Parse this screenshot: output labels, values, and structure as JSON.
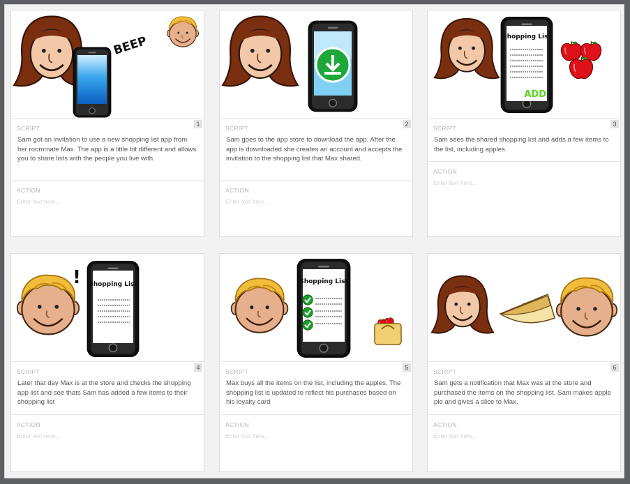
{
  "labels": {
    "script": "SCRIPT",
    "action": "ACTION",
    "placeholder": "Enter text here..."
  },
  "panels": [
    {
      "number": "1",
      "script": "Sam got an invitation to use a  new shopping list app from her roommate Max. The app is a little bit different and allows you to share lists with the people you live with.",
      "picture": {
        "sound": "BEEP"
      }
    },
    {
      "number": "2",
      "script": "Sam goes to the app store to download the app. After the app is downloaded she creates an account and accepts the invitation to the shopping list that Max shared."
    },
    {
      "number": "3",
      "script": "Sam sees the shared shopping list and adds a few items to the list, including apples.",
      "picture": {
        "screen_title": "Shopping List",
        "add": "ADD"
      }
    },
    {
      "number": "4",
      "script": "Later that day Max is at the store and checks the shopping app list and see thats Sam has added a few items to their shopping list",
      "picture": {
        "screen_title": "Shopping List",
        "mark": "!"
      }
    },
    {
      "number": "5",
      "script": "Max buys all the items on the list, including the apples. The shopping list is updated to reflect his purchases based on his loyalty card",
      "picture": {
        "screen_title": "Shopping List"
      }
    },
    {
      "number": "6",
      "script": "Sam gets a notification that Max was at the store and purchased the items on the shopping list. Sam makes apple pie and gives a slice to Max."
    }
  ]
}
